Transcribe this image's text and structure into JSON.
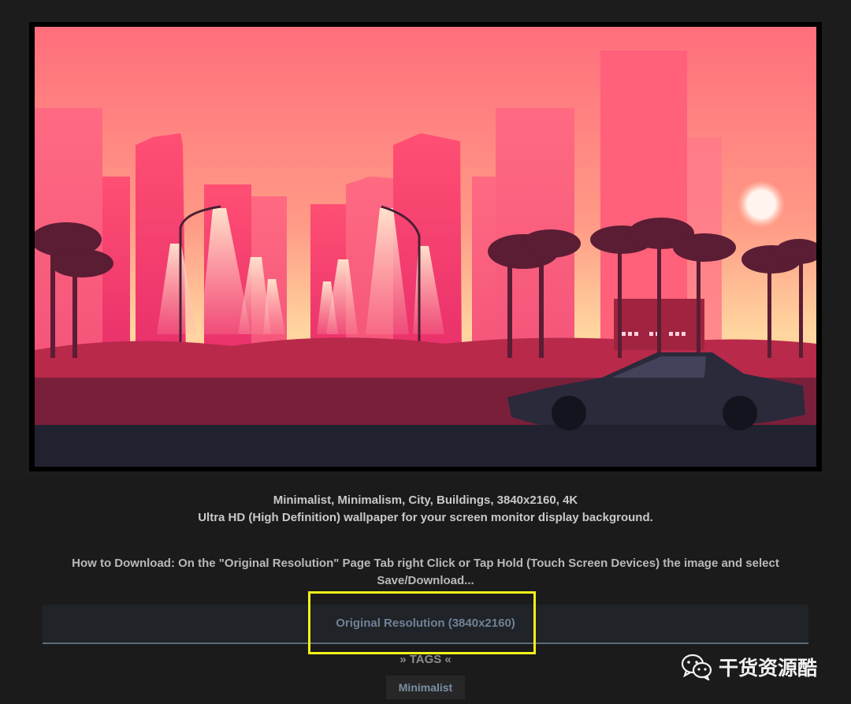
{
  "image": {
    "subject": "wallpaper"
  },
  "description": {
    "title": "Minimalist, Minimalism, City, Buildings, 3840x2160, 4K",
    "subtitle": "Ultra HD (High Definition) wallpaper for your screen monitor display background."
  },
  "howto": {
    "text": "How to Download: On the \"Original Resolution\" Page Tab right Click or Tap Hold (Touch Screen Devices) the image and select Save/Download..."
  },
  "tabs": {
    "original_resolution": "Original Resolution (3840x2160)"
  },
  "tags": {
    "heading": "» TAGS «",
    "items": [
      "Minimalist"
    ]
  },
  "watermark": {
    "text": "干货资源酷",
    "icon": "wechat-icon"
  },
  "colors": {
    "background": "#1b1b1b",
    "tab_text": "#6f8197",
    "highlight": "#f2f21a"
  }
}
